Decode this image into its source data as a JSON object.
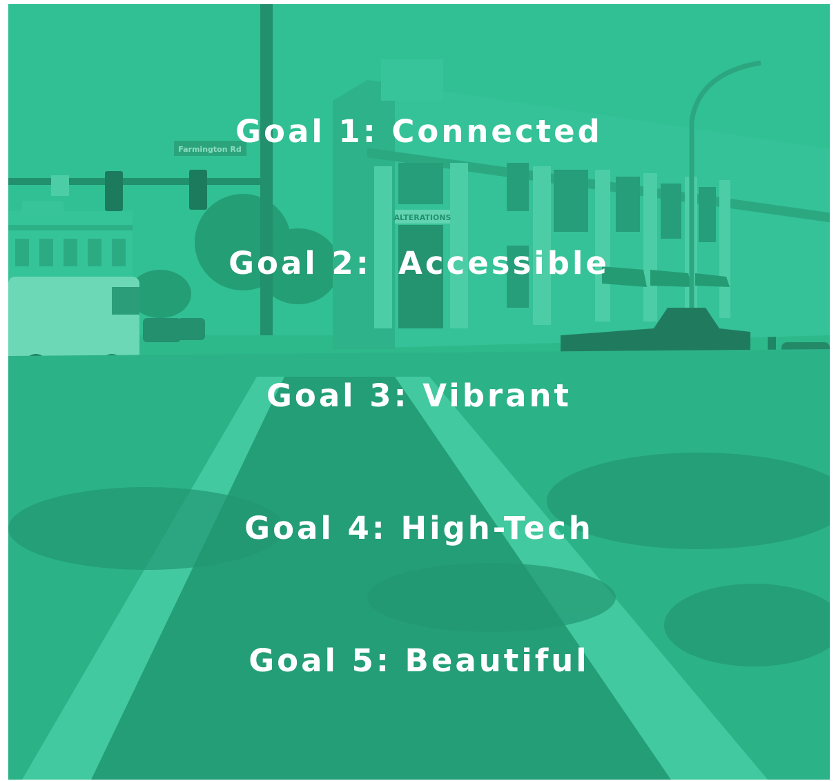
{
  "colors": {
    "tint": "#2fb98a",
    "text": "#ffffff"
  },
  "photo": {
    "street_sign": "Farmington Rd",
    "storefront_sign": "ALTERATIONS"
  },
  "goals": [
    "Goal 1: Connected",
    "Goal 2:  Accessible",
    "Goal 3: Vibrant",
    "Goal 4: High-Tech",
    "Goal 5: Beautiful"
  ]
}
